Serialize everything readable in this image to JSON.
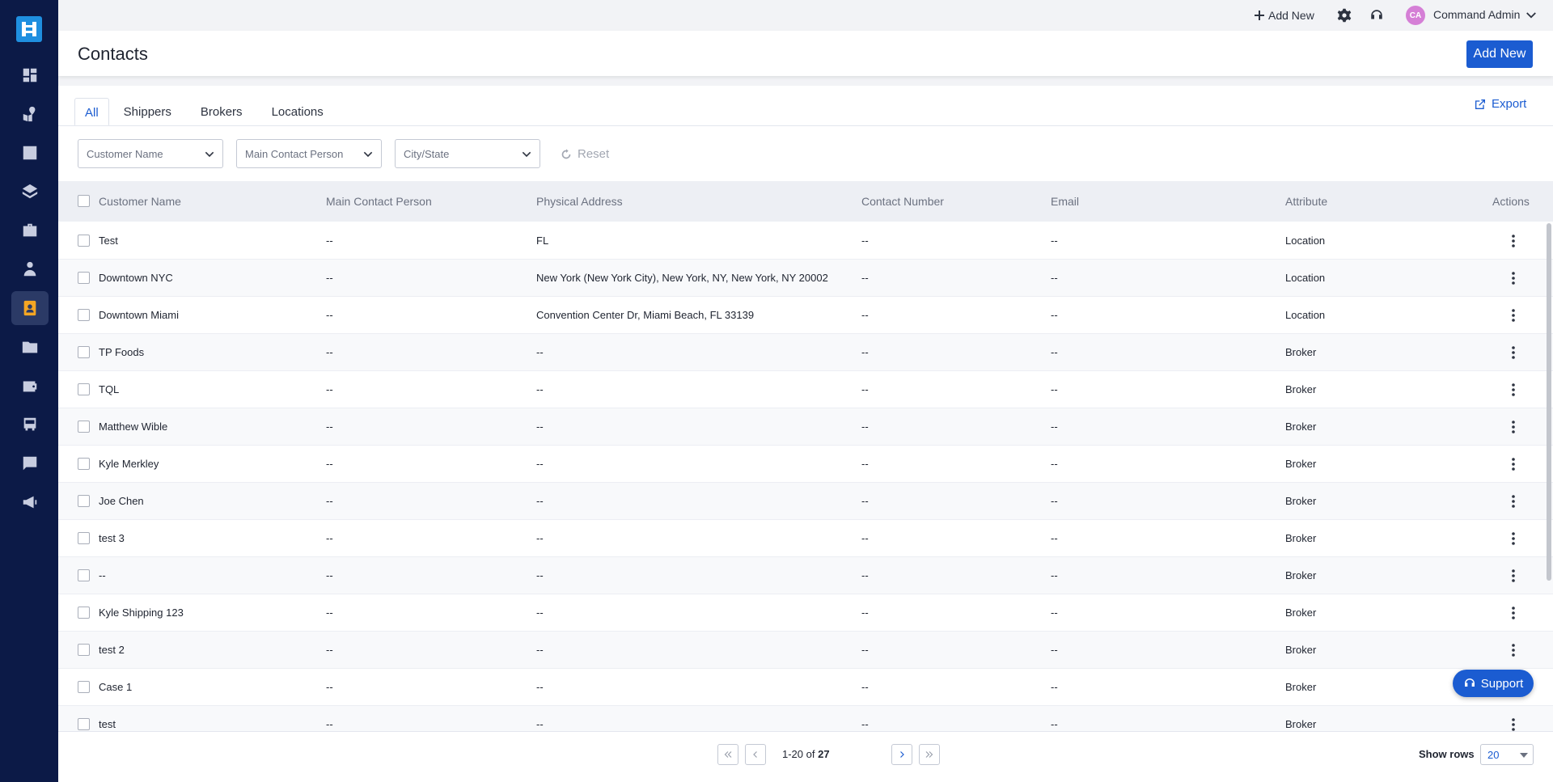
{
  "topbar": {
    "add_new_label": "Add New",
    "user_initials": "CA",
    "user_name": "Command Admin"
  },
  "header": {
    "title": "Contacts",
    "add_new_button": "Add New"
  },
  "tabs": [
    {
      "label": "All",
      "active": true
    },
    {
      "label": "Shippers",
      "active": false
    },
    {
      "label": "Brokers",
      "active": false
    },
    {
      "label": "Locations",
      "active": false
    }
  ],
  "export_label": "Export",
  "filters": {
    "customer_name": "Customer Name",
    "main_contact": "Main Contact Person",
    "city_state": "City/State",
    "reset": "Reset"
  },
  "table": {
    "columns": [
      "Customer Name",
      "Main Contact Person",
      "Physical Address",
      "Contact Number",
      "Email",
      "Attribute",
      "Actions"
    ],
    "rows": [
      [
        "Test",
        "--",
        "FL",
        "--",
        "--",
        "Location"
      ],
      [
        "Downtown NYC",
        "--",
        "New York (New York City), New York, NY, New York, NY 20002",
        "--",
        "--",
        "Location"
      ],
      [
        "Downtown Miami",
        "--",
        "Convention Center Dr, Miami Beach, FL 33139",
        "--",
        "--",
        "Location"
      ],
      [
        "TP Foods",
        "--",
        "--",
        "--",
        "--",
        "Broker"
      ],
      [
        "TQL",
        "--",
        "--",
        "--",
        "--",
        "Broker"
      ],
      [
        "Matthew Wible",
        "--",
        "--",
        "--",
        "--",
        "Broker"
      ],
      [
        "Kyle Merkley",
        "--",
        "--",
        "--",
        "--",
        "Broker"
      ],
      [
        "Joe Chen",
        "--",
        "--",
        "--",
        "--",
        "Broker"
      ],
      [
        "test 3",
        "--",
        "--",
        "--",
        "--",
        "Broker"
      ],
      [
        "--",
        "--",
        "--",
        "--",
        "--",
        "Broker"
      ],
      [
        "Kyle Shipping 123",
        "--",
        "--",
        "--",
        "--",
        "Broker"
      ],
      [
        "test 2",
        "--",
        "--",
        "--",
        "--",
        "Broker"
      ],
      [
        "Case 1",
        "--",
        "--",
        "--",
        "--",
        "Broker"
      ],
      [
        "test",
        "--",
        "--",
        "--",
        "--",
        "Broker"
      ]
    ]
  },
  "pagination": {
    "range": "1-20",
    "of": "of",
    "total": "27",
    "show_rows_label": "Show rows",
    "rows_per_page": "20"
  },
  "support_label": "Support",
  "colors": {
    "sidebar": "#0c1a47",
    "primary": "#1b5cd1",
    "logo": "#1f8fe0",
    "active_icon": "#f5a623"
  }
}
